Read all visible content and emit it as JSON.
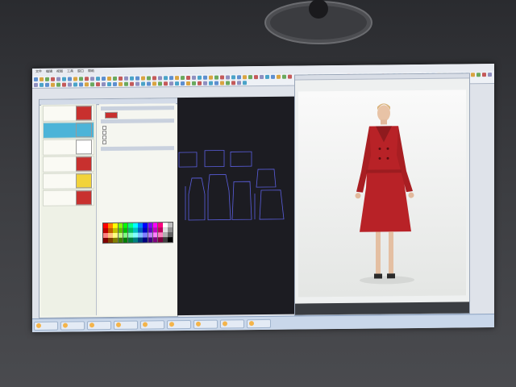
{
  "menu": [
    "文件",
    "编辑",
    "视图",
    "工具",
    "窗口",
    "帮助"
  ],
  "colors": {
    "screen_bg": "#dfe3ea",
    "accent_blue": "#4cb4d8",
    "fabric_red": "#c8302e",
    "yellow": "#f2d33a",
    "canvas": "#1c1c22",
    "pattern_line": "#5b5fe0"
  },
  "layers": [
    {
      "label": "",
      "swatch": "#c8302e",
      "selected": false
    },
    {
      "label": "",
      "swatch": "#4cb4d8",
      "selected": true
    },
    {
      "label": "",
      "swatch": "#ffffff",
      "selected": false
    },
    {
      "label": "",
      "swatch": "#c8302e",
      "selected": false
    },
    {
      "label": "",
      "swatch": "#f2d33a",
      "selected": false
    },
    {
      "label": "",
      "swatch": "#c8302e",
      "selected": false
    }
  ],
  "palette": [
    "#ff0000",
    "#ff8000",
    "#ffff00",
    "#80ff00",
    "#00ff00",
    "#00ff80",
    "#00ffff",
    "#0080ff",
    "#0000ff",
    "#8000ff",
    "#ff00ff",
    "#ff0080",
    "#ffffff",
    "#c0c0c0",
    "#c00000",
    "#c06000",
    "#c0c000",
    "#60c000",
    "#00c000",
    "#00c060",
    "#00c0c0",
    "#0060c0",
    "#0000c0",
    "#6000c0",
    "#c000c0",
    "#c00060",
    "#e0e0e0",
    "#909090",
    "#ff8080",
    "#ffc080",
    "#ffff80",
    "#c0ff80",
    "#80ff80",
    "#80ffc0",
    "#80ffff",
    "#80c0ff",
    "#8080ff",
    "#c080ff",
    "#ff80ff",
    "#ff80c0",
    "#b0b0b0",
    "#606060",
    "#800000",
    "#804000",
    "#808000",
    "#408000",
    "#008000",
    "#008040",
    "#008080",
    "#004080",
    "#000080",
    "#400080",
    "#800080",
    "#800040",
    "#404040",
    "#000000"
  ],
  "taskbar": {
    "items": [
      "",
      "",
      "",
      "",
      "",
      "",
      "",
      "",
      ""
    ],
    "clock": ""
  }
}
